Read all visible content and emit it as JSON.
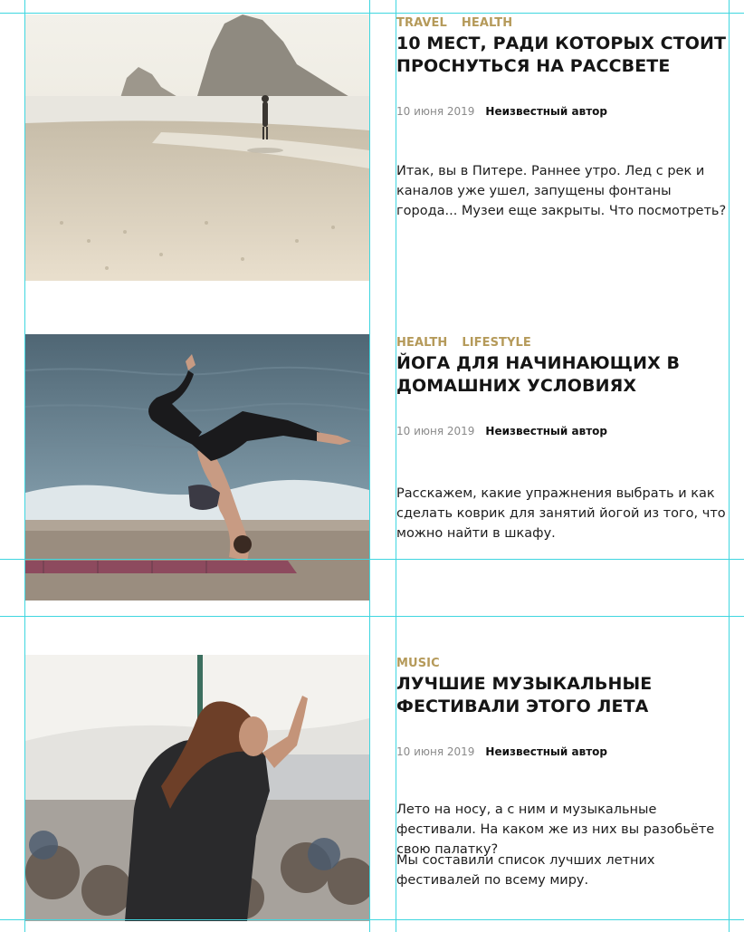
{
  "colors": {
    "accent": "#b59a5a",
    "guides": "#3fd6e0"
  },
  "articles": [
    {
      "image": {
        "subject": "person walking on a misty beach at sunrise"
      },
      "tags": [
        "TRAVEL",
        "HEALTH"
      ],
      "title": "10 МЕСТ, РАДИ КОТОРЫХ СТОИТ ПРОСНУТЬСЯ НА РАССВЕТЕ",
      "date": "10 июня 2019",
      "author": "Неизвестный автор",
      "excerpt": [
        "Итак, вы в Питере. Раннее утро. Лед с рек и каналов уже ушел, запущены фонтаны города... Музеи еще закрыты. Что посмотреть?"
      ]
    },
    {
      "image": {
        "subject": "woman doing a yoga pose on a beach by the sea"
      },
      "tags": [
        "HEALTH",
        "LIFESTYLE"
      ],
      "title": "ЙОГА ДЛЯ НАЧИНАЮЩИХ В ДОМАШНИХ УСЛОВИЯХ",
      "date": "10 июня 2019",
      "author": "Неизвестный автор",
      "excerpt": [
        "Расскажем, какие упражнения выбрать и как сделать коврик для занятий йогой из того, что можно найти в шкафу."
      ]
    },
    {
      "image": {
        "subject": "woman dancing in a crowd at a music festival"
      },
      "tags": [
        "MUSIC"
      ],
      "title": "ЛУЧШИЕ МУЗЫКАЛЬНЫЕ ФЕСТИВАЛИ ЭТОГО ЛЕТА",
      "date": "10 июня 2019",
      "author": "Неизвестный автор",
      "excerpt": [
        "Лето на носу, а с ним и музыкальные фестивали. На каком же из них вы разобьёте свою палатку?",
        "Мы составили список лучших летних фестивалей по всему миру."
      ]
    }
  ]
}
